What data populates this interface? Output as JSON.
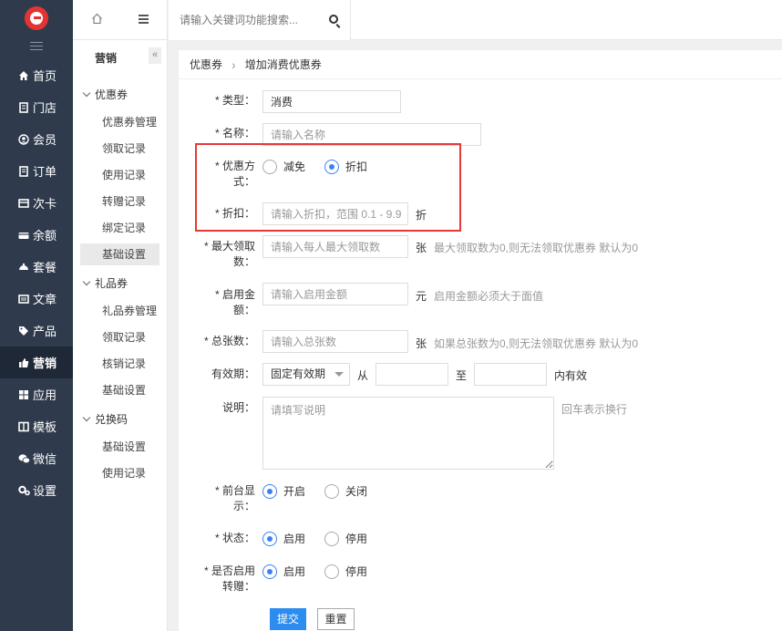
{
  "nav": {
    "items": [
      {
        "label": "首页",
        "icon": "home-icon"
      },
      {
        "label": "门店",
        "icon": "store-icon"
      },
      {
        "label": "会员",
        "icon": "member-icon"
      },
      {
        "label": "订单",
        "icon": "order-icon"
      },
      {
        "label": "次卡",
        "icon": "card-icon"
      },
      {
        "label": "余额",
        "icon": "balance-icon"
      },
      {
        "label": "套餐",
        "icon": "package-icon"
      },
      {
        "label": "文章",
        "icon": "article-icon"
      },
      {
        "label": "产品",
        "icon": "product-icon"
      },
      {
        "label": "营销",
        "icon": "thumbs-up-icon"
      },
      {
        "label": "应用",
        "icon": "apps-icon"
      },
      {
        "label": "模板",
        "icon": "template-icon"
      },
      {
        "label": "微信",
        "icon": "wechat-icon"
      },
      {
        "label": "设置",
        "icon": "settings-icon"
      }
    ],
    "active": "营销"
  },
  "subnav": {
    "title": "营销",
    "collapse_glyph": "«",
    "groups": [
      {
        "label": "优惠券",
        "items": [
          "优惠券管理",
          "领取记录",
          "使用记录",
          "转赠记录",
          "绑定记录",
          "基础设置"
        ]
      },
      {
        "label": "礼品券",
        "items": [
          "礼品券管理",
          "领取记录",
          "核销记录",
          "基础设置"
        ]
      },
      {
        "label": "兑换码",
        "items": [
          "基础设置",
          "使用记录"
        ]
      }
    ],
    "active_item": "基础设置"
  },
  "topbar": {
    "search_placeholder": "请输入关键词功能搜索..."
  },
  "breadcrumb": {
    "parent": "优惠券",
    "separator": "›",
    "current": "增加消费优惠券"
  },
  "form": {
    "type": {
      "label": "* 类型：",
      "value": "消费"
    },
    "name": {
      "label": "* 名称：",
      "placeholder": "请输入名称"
    },
    "discount_mode": {
      "label_line1": "* 优惠方",
      "label_line2": "式：",
      "options": [
        "减免",
        "折扣"
      ],
      "selected": "折扣"
    },
    "discount": {
      "label": "* 折扣：",
      "placeholder": "请输入折扣，范围 0.1 - 9.9",
      "suffix": "折"
    },
    "max_claim": {
      "label_line1": "* 最大领取",
      "label_line2": "数：",
      "placeholder": "请输入每人最大领取数",
      "suffix": "张",
      "hint": "最大领取数为0,则无法领取优惠券 默认为0"
    },
    "min_amount": {
      "label_line1": "* 启用金",
      "label_line2": "额：",
      "placeholder": "请输入启用金额",
      "suffix": "元",
      "hint": "启用金额必须大于面值"
    },
    "total": {
      "label": "* 总张数：",
      "placeholder": "请输入总张数",
      "suffix": "张",
      "hint": "如果总张数为0,则无法领取优惠券 默认为0"
    },
    "validity": {
      "label": "有效期：",
      "select": "固定有效期",
      "from": "从",
      "to": "至",
      "suffix": "内有效"
    },
    "description": {
      "label": "说明：",
      "placeholder": "请填写说明",
      "hint": "回车表示换行"
    },
    "frontend_display": {
      "label_line1": "* 前台显",
      "label_line2": "示：",
      "options": [
        "开启",
        "关闭"
      ],
      "selected": "开启"
    },
    "status": {
      "label": "* 状态：",
      "options": [
        "启用",
        "停用"
      ],
      "selected": "启用"
    },
    "transfer": {
      "label_line1": "* 是否启用",
      "label_line2": "转赠：",
      "options": [
        "启用",
        "停用"
      ],
      "selected": "启用"
    },
    "submit_label": "提交",
    "reset_label": "重置"
  },
  "colors": {
    "nav_bg": "#2f3b4c",
    "primary": "#2d8cf0",
    "highlight": "#e53935"
  }
}
